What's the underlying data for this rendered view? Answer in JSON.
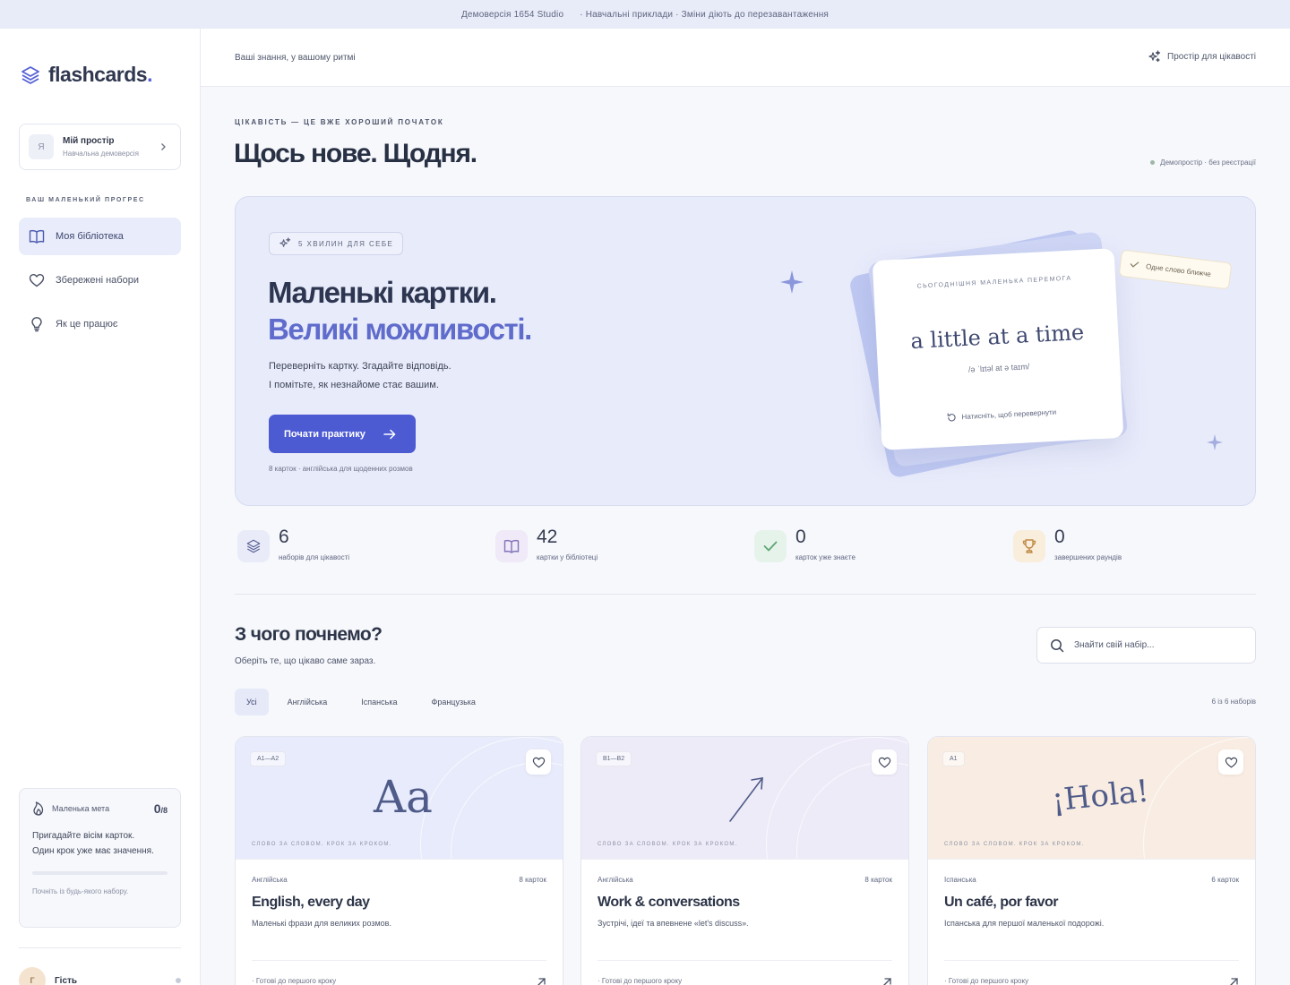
{
  "topbar": {
    "left": "Демоверсія 1654 Studio",
    "right": "· Навчальні приклади · Зміни діють до перезавантаження"
  },
  "sidebar": {
    "logo_text": "flashcards",
    "logo_dot": ".",
    "space": {
      "avatar": "Я",
      "name": "Мій простір",
      "sub": "Навчальна демоверсія"
    },
    "section_label": "ВАШ МАЛЕНЬКИЙ ПРОГРЕС",
    "nav": [
      {
        "label": "Моя бібліотека",
        "icon": "book-icon",
        "active": true
      },
      {
        "label": "Збережені набори",
        "icon": "heart-icon",
        "active": false
      },
      {
        "label": "Як це працює",
        "icon": "bulb-icon",
        "active": false
      }
    ],
    "goal": {
      "label": "Маленька мета",
      "count": "0",
      "total": "/8",
      "progress": 0,
      "text_line1": "Пригадайте вісім карток.",
      "text_line2": "Один крок уже має значення.",
      "hint": "Почніть із будь-якого набору."
    },
    "user": {
      "avatar": "Г",
      "name": "Гість"
    }
  },
  "header": {
    "tagline": "Ваші знання, у вашому ритмі",
    "right_label": "Простір для цікавості"
  },
  "page": {
    "eyebrow": "ЦІКАВІСТЬ — ЦЕ ВЖЕ ХОРОШИЙ ПОЧАТОК",
    "title": "Щось нове. Щодня.",
    "demo_note": "Демопростір · без реєстрації"
  },
  "hero": {
    "chip": "5 ХВИЛИН ДЛЯ СЕБЕ",
    "title_line1": "Маленькі картки.",
    "title_line2": "Великі можливості.",
    "desc_line1": "Переверніть картку. Згадайте відповідь.",
    "desc_line2": "І помітьте, як незнайоме стає вашим.",
    "cta": "Почати практику",
    "meta": "8 карток · англійська для щоденних розмов",
    "card": {
      "eyebrow": "СЬОГОДНІШНЯ МАЛЕНЬКА ПЕРЕМОГА",
      "word": "a little at a time",
      "ipa": "/ə ˈlɪtəl at ə taɪm/",
      "hint": "Натисніть, щоб перевернути"
    },
    "sticky": "Одне слово ближче"
  },
  "stats": [
    {
      "value": "6",
      "label": "наборів для цікавості",
      "icon": "layers-icon",
      "color": "#e9ecf8"
    },
    {
      "value": "42",
      "label": "картки у бібліотеці",
      "icon": "book-open-icon",
      "color": "#efe9f8"
    },
    {
      "value": "0",
      "label": "карток уже знаєте",
      "icon": "check-icon",
      "color": "#e6f3ea"
    },
    {
      "value": "0",
      "label": "завершених раундів",
      "icon": "trophy-icon",
      "color": "#f9eddc"
    }
  ],
  "section": {
    "title": "З чого почнемо?",
    "subtitle": "Оберіть те, що цікаво саме зараз.",
    "search_placeholder": "Знайти свій набір...",
    "filters": [
      "Усі",
      "Англійська",
      "Іспанська",
      "Французька"
    ],
    "count_note": "6 із 6 наборів"
  },
  "decks": [
    {
      "level": "A1—A2",
      "art": "Aa",
      "motto": "СЛОВО ЗА СЛОВОМ. КРОК ЗА КРОКОМ.",
      "lang": "Англійська",
      "cards": "8 карток",
      "title": "English, every day",
      "desc": "Маленькі фрази для великих розмов.",
      "foot": "· Готові до першого кроку",
      "bg": "#e8ebfb"
    },
    {
      "level": "B1—B2",
      "art": "arrow",
      "motto": "СЛОВО ЗА СЛОВОМ. КРОК ЗА КРОКОМ.",
      "lang": "Англійська",
      "cards": "8 карток",
      "title": "Work & conversations",
      "desc": "Зустрічі, ідеї та впевнене «let's discuss».",
      "foot": "· Готові до першого кроку",
      "bg": "#eeebf8"
    },
    {
      "level": "A1",
      "art": "¡Hola!",
      "motto": "СЛОВО ЗА СЛОВОМ. КРОК ЗА КРОКОМ.",
      "lang": "Іспанська",
      "cards": "6 карток",
      "title": "Un café, por favor",
      "desc": "Іспанська для першої маленької подорожі.",
      "foot": "· Готові до першого кроку",
      "bg": "#f9ede3"
    }
  ]
}
